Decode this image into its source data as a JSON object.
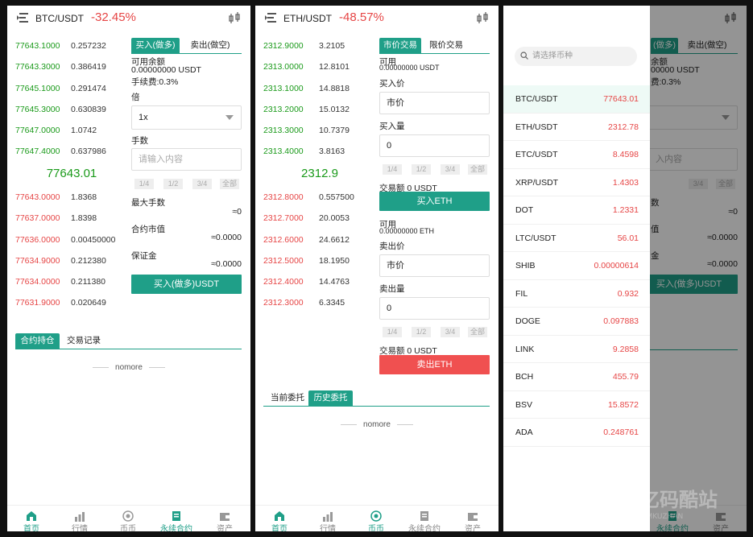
{
  "p1": {
    "pair": "BTC/USDT",
    "change": "-32.45%",
    "bids": [
      {
        "p": "77643.1000",
        "q": "0.257232"
      },
      {
        "p": "77643.3000",
        "q": "0.386419"
      },
      {
        "p": "77645.1000",
        "q": "0.291474"
      },
      {
        "p": "77645.3000",
        "q": "0.630839"
      },
      {
        "p": "77647.0000",
        "q": "1.0742"
      },
      {
        "p": "77647.4000",
        "q": "0.637986"
      }
    ],
    "last": "77643.01",
    "asks": [
      {
        "p": "77643.0000",
        "q": "1.8368"
      },
      {
        "p": "77637.0000",
        "q": "1.8398"
      },
      {
        "p": "77636.0000",
        "q": "0.00450000"
      },
      {
        "p": "77634.9000",
        "q": "0.212380"
      },
      {
        "p": "77634.0000",
        "q": "0.211380"
      },
      {
        "p": "77631.9000",
        "q": "0.020649"
      }
    ],
    "tab_buy": "买入(做多)",
    "tab_sell": "卖出(做空)",
    "avail_label": "可用余额",
    "avail_value": "0.00000000 USDT",
    "fee": "手续费:0.3%",
    "lev_label": "倍",
    "lev_value": "1x",
    "hands_label": "手数",
    "hands_placeholder": "请输入内容",
    "pcts": [
      "1/4",
      "1/2",
      "3/4",
      "全部"
    ],
    "max_label": "最大手数",
    "max_value": "≈0",
    "mv_label": "合约市值",
    "mv_value": "≈0.0000",
    "margin_label": "保证金",
    "margin_value": "≈0.0000",
    "submit": "买入(做多)USDT",
    "tab_pos": "合约持仓",
    "tab_hist": "交易记录",
    "nomore": "nomore"
  },
  "p2": {
    "pair": "ETH/USDT",
    "change": "-48.57%",
    "bids": [
      {
        "p": "2312.9000",
        "q": "3.2105"
      },
      {
        "p": "2313.0000",
        "q": "12.8101"
      },
      {
        "p": "2313.1000",
        "q": "14.8818"
      },
      {
        "p": "2313.2000",
        "q": "15.0132"
      },
      {
        "p": "2313.3000",
        "q": "10.7379"
      },
      {
        "p": "2313.4000",
        "q": "3.8163"
      }
    ],
    "last": "2312.9",
    "asks": [
      {
        "p": "2312.8000",
        "q": "0.557500"
      },
      {
        "p": "2312.7000",
        "q": "20.0053"
      },
      {
        "p": "2312.6000",
        "q": "24.6612"
      },
      {
        "p": "2312.5000",
        "q": "18.1950"
      },
      {
        "p": "2312.4000",
        "q": "14.4763"
      },
      {
        "p": "2312.3000",
        "q": "6.3345"
      }
    ],
    "tab_market": "市价交易",
    "tab_limit": "限价交易",
    "avail_label": "可用",
    "avail_buy": "0.00000000 USDT",
    "buy_price_label": "买入价",
    "buy_price": "市价",
    "buy_qty_label": "买入量",
    "buy_qty": "0",
    "pcts": [
      "1/4",
      "1/2",
      "3/4",
      "全部"
    ],
    "buy_amount": "交易额 0 USDT",
    "buy_btn": "买入ETH",
    "avail_sell": "0.00000000 ETH",
    "sell_price_label": "卖出价",
    "sell_price": "市价",
    "sell_qty_label": "卖出量",
    "sell_qty": "0",
    "sell_amount": "交易额 0 USDT",
    "sell_btn": "卖出ETH",
    "tab_current": "当前委托",
    "tab_history": "历史委托",
    "nomore": "nomore"
  },
  "p3": {
    "search_placeholder": "请选择币种",
    "markets": [
      {
        "n": "BTC/USDT",
        "v": "77643.01"
      },
      {
        "n": "ETH/USDT",
        "v": "2312.78"
      },
      {
        "n": "ETC/USDT",
        "v": "8.4598"
      },
      {
        "n": "XRP/USDT",
        "v": "1.4303"
      },
      {
        "n": "DOT",
        "v": "1.2331"
      },
      {
        "n": "LTC/USDT",
        "v": "56.01"
      },
      {
        "n": "SHIB",
        "v": "0.00000614"
      },
      {
        "n": "FIL",
        "v": "0.932"
      },
      {
        "n": "DOGE",
        "v": "0.097883"
      },
      {
        "n": "LINK",
        "v": "9.2858"
      },
      {
        "n": "BCH",
        "v": "455.79"
      },
      {
        "n": "BSV",
        "v": "15.8572"
      },
      {
        "n": "ADA",
        "v": "0.248761"
      }
    ],
    "bg_tab_buy": "(做多)",
    "bg_tab_sell": "卖出(做空)",
    "bg_avail": "余额",
    "bg_avail_value": "00000 USDT",
    "bg_fee": "费:0.3%",
    "bg_hands_placeholder": "入内容",
    "bg_pct": "3/4",
    "bg_pct_all": "全部",
    "bg_max": "数",
    "bg_max_value": "≈0",
    "bg_mv": "值",
    "bg_mv_value": "≈0.0000",
    "bg_margin": "金",
    "bg_margin_value": "≈0.0000",
    "bg_submit": "买入(做多)USDT",
    "watermark": "亿码酷站",
    "watermark_sub": "YMKUZHAN"
  },
  "tabbar": [
    "首页",
    "行情",
    "币币",
    "永续合约",
    "资产"
  ],
  "colors": {
    "accent": "#1f9f88",
    "up": "#1a9a1a",
    "down": "#e64545",
    "sell_btn": "#f05050"
  }
}
